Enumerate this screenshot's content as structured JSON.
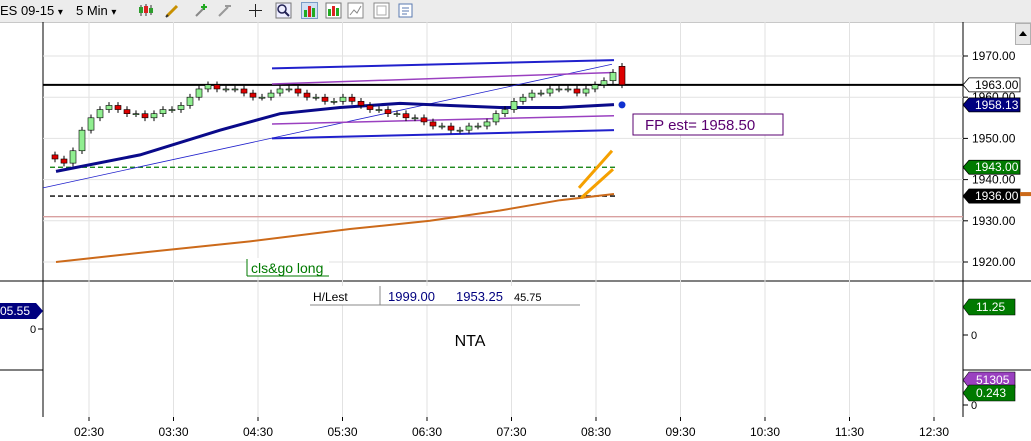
{
  "toolbar": {
    "instrument": "ES 09-15",
    "interval": "5 Min",
    "dropdown_glyph": "▾",
    "icons": [
      "candlestick-icon",
      "pencil-icon",
      "add-indicator-icon",
      "remove-indicator-icon",
      "crosshair-icon",
      "zoom-icon",
      "bar-chart-icon",
      "chart-trader-icon",
      "data-box-icon",
      "properties-icon"
    ]
  },
  "chart_data": [
    {
      "type": "candlestick",
      "panel": "price",
      "x_ticks": [
        "02:30",
        "03:30",
        "04:30",
        "05:30",
        "06:30",
        "07:30",
        "08:30",
        "09:30",
        "10:30",
        "11:30",
        "12:30"
      ],
      "y_ticks": [
        1920,
        1930,
        1940,
        1950,
        1960,
        1970
      ],
      "ylim": [
        1916,
        1972
      ],
      "price_labels": [
        {
          "text": "1963.00",
          "value": 1963.0,
          "bg": "#ffffff",
          "fg": "#000000"
        },
        {
          "text": "1958.13",
          "value": 1958.13,
          "bg": "#00007f",
          "fg": "#ffffff"
        },
        {
          "text": "1943.00",
          "value": 1943.0,
          "bg": "#007a00",
          "fg": "#ffffff"
        },
        {
          "text": "1936.00",
          "value": 1936.0,
          "bg": "#000000",
          "fg": "#ffffff"
        }
      ],
      "horizontal_lines": [
        {
          "value": 1963.0,
          "color": "#000000",
          "style": "solid"
        },
        {
          "value": 1943.0,
          "color": "#007a00",
          "style": "dashed"
        },
        {
          "value": 1936.0,
          "color": "#000000",
          "style": "dashed"
        },
        {
          "value": 1931.0,
          "color": "#d9a0a0",
          "style": "solid"
        }
      ],
      "annotations": [
        {
          "text": "FP est= 1958.50",
          "color": "#5a0070"
        },
        {
          "text": "cls&go long",
          "color": "#007a00"
        }
      ],
      "table": {
        "label": "H/Lest",
        "high": "1999.00",
        "low": "1953.25",
        "range": "45.75"
      },
      "colors": {
        "up": "#90ee90",
        "down": "#dd0000",
        "ma_fast": "#0a0a8a",
        "ma_slow": "#cc6a1a",
        "channel": "#2020cc",
        "channel_mid": "#9a40c0"
      }
    },
    {
      "type": "line",
      "panel": "indicator",
      "title": "NTA",
      "labels": [
        {
          "text": "05.55",
          "bg": "#00007f",
          "fg": "#ffffff",
          "side": "left"
        },
        {
          "text": "11.25",
          "bg": "#007a00",
          "fg": "#ffffff",
          "side": "right"
        },
        {
          "text": "51305",
          "bg": "#9a40c0",
          "fg": "#ffffff",
          "side": "right"
        },
        {
          "text": "0.243",
          "bg": "#007a00",
          "fg": "#ffffff",
          "side": "right"
        }
      ],
      "zero_ticks": [
        "0",
        "0",
        "0"
      ]
    }
  ]
}
